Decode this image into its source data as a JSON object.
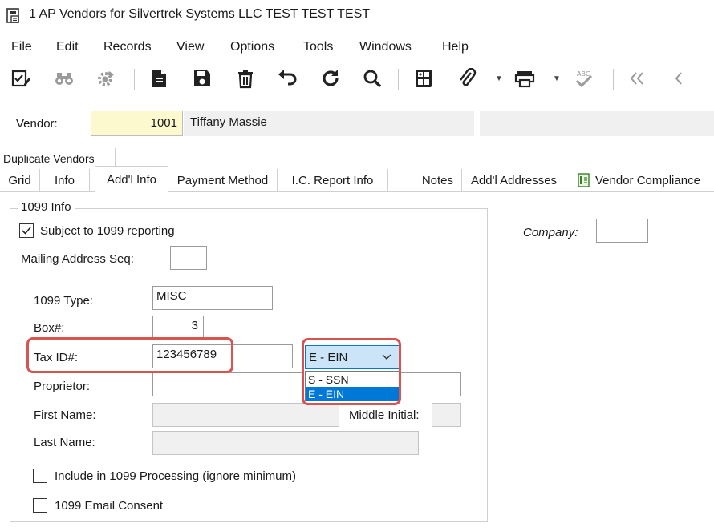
{
  "window": {
    "title": "1 AP Vendors for Silvertrek Systems LLC TEST TEST TEST"
  },
  "menu": [
    "File",
    "Edit",
    "Records",
    "View",
    "Options",
    "Tools",
    "Windows",
    "Help"
  ],
  "toolbar": {
    "icons": [
      "checklist-edit-icon",
      "binoculars-icon",
      "gear-icon",
      "document-icon",
      "save-icon",
      "delete-icon",
      "undo-icon",
      "refresh-icon",
      "search-icon",
      "calculator-icon",
      "attach-icon",
      "print-icon",
      "spellcheck-icon",
      "first-record-icon",
      "previous-record-icon"
    ]
  },
  "vendor": {
    "label": "Vendor:",
    "number": "1001",
    "name": "Tiffany Massie"
  },
  "tabs": {
    "top": "Duplicate Vendors",
    "items": [
      "Grid",
      "Info",
      "Add'l Info",
      "Payment Method",
      "I.C. Report Info",
      "Notes",
      "Add'l Addresses",
      "Vendor Compliance"
    ],
    "active": "Add'l Info"
  },
  "form": {
    "group_title": "1099 Info",
    "subject_1099": {
      "label": "Subject to 1099 reporting",
      "checked": true
    },
    "mailing_seq": {
      "label": "Mailing Address Seq:",
      "value": ""
    },
    "type": {
      "label": "1099 Type:",
      "value": "MISC"
    },
    "box": {
      "label": "Box#:",
      "value": "3"
    },
    "tax_id": {
      "label": "Tax ID#:",
      "value": "123456789"
    },
    "tax_id_type": {
      "value": "E - EIN",
      "options": [
        "S - SSN",
        "E - EIN"
      ],
      "selected_index": 1
    },
    "proprietor": {
      "label": "Proprietor:",
      "value": ""
    },
    "first_name": {
      "label": "First Name:",
      "value": ""
    },
    "middle_initial": {
      "label": "Middle Initial:",
      "value": ""
    },
    "last_name": {
      "label": "Last Name:",
      "value": ""
    },
    "include_processing": {
      "label": "Include in 1099 Processing (ignore minimum)",
      "checked": false
    },
    "email_consent": {
      "label": "1099 Email Consent",
      "checked": false
    }
  },
  "company": {
    "label": "Company:",
    "value": ""
  },
  "colors": {
    "highlight": "#d9534f",
    "accent": "#0078d7",
    "key_field": "#fdf9cf"
  }
}
